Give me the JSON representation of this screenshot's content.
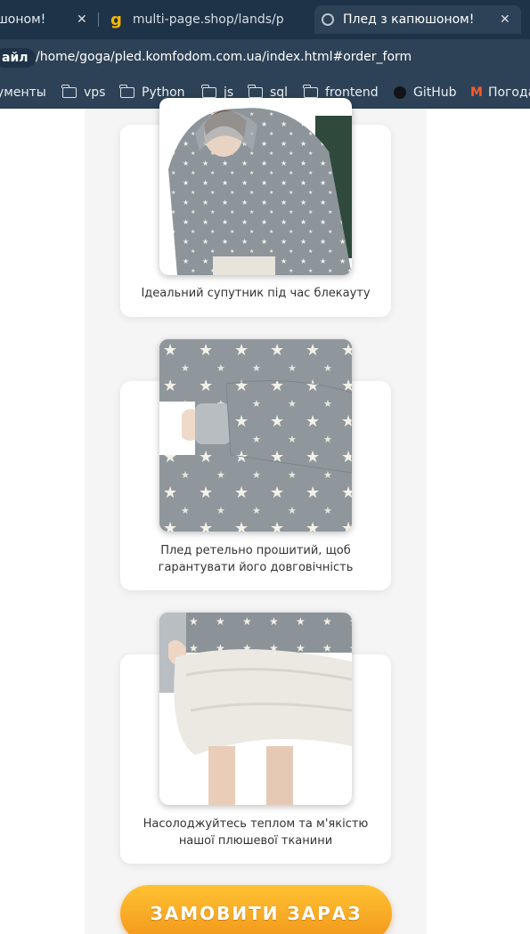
{
  "browser": {
    "tabs": [
      {
        "title": "шоном!"
      },
      {
        "title": "multi-page.shop/lands/pl"
      },
      {
        "title": "Плед з капюшоном!"
      }
    ],
    "address": {
      "chip": "айл",
      "url": "/home/goga/pled.komfodom.com.ua/index.html#order_form"
    },
    "bookmarks": [
      {
        "label": "ументы"
      },
      {
        "label": "vps"
      },
      {
        "label": "Python"
      },
      {
        "label": "js"
      },
      {
        "label": "sql"
      },
      {
        "label": "frontend"
      },
      {
        "label": "GitHub"
      },
      {
        "label": "Погода"
      }
    ]
  },
  "cards": [
    {
      "caption": "Ідеальний супутник під час блекауту"
    },
    {
      "caption": "Плед ретельно прошитий, щоб гарантувати його довговічність"
    },
    {
      "caption": "Насолоджуйтесь теплом та м'якістю нашої плюшевої тканини"
    }
  ],
  "cta": {
    "label": "ЗАМОВИТИ ЗАРАЗ"
  },
  "colors": {
    "tabbar": "#1e3347",
    "toolbar": "#2d4256",
    "cta_top": "#ffc233",
    "cta_bottom": "#f2961a",
    "column_bg": "#f5f5f5"
  }
}
